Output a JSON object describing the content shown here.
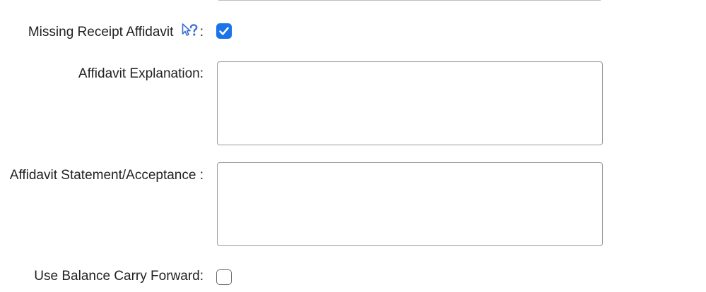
{
  "form": {
    "missing_receipt": {
      "label": "Missing Receipt Affidavit",
      "colon": ":",
      "help_icon": "pointer-question-icon",
      "checked": true
    },
    "affidavit_explanation": {
      "label": "Affidavit Explanation:",
      "value": ""
    },
    "affidavit_statement": {
      "label": "Affidavit Statement/Acceptance :",
      "value": ""
    },
    "balance_carry_forward": {
      "label": "Use Balance Carry Forward:",
      "checked": false
    }
  },
  "colors": {
    "checkbox_checked": "#1a73e8",
    "help_icon": "#3b6fd6",
    "text": "#222222",
    "border": "#9a9a9a"
  }
}
